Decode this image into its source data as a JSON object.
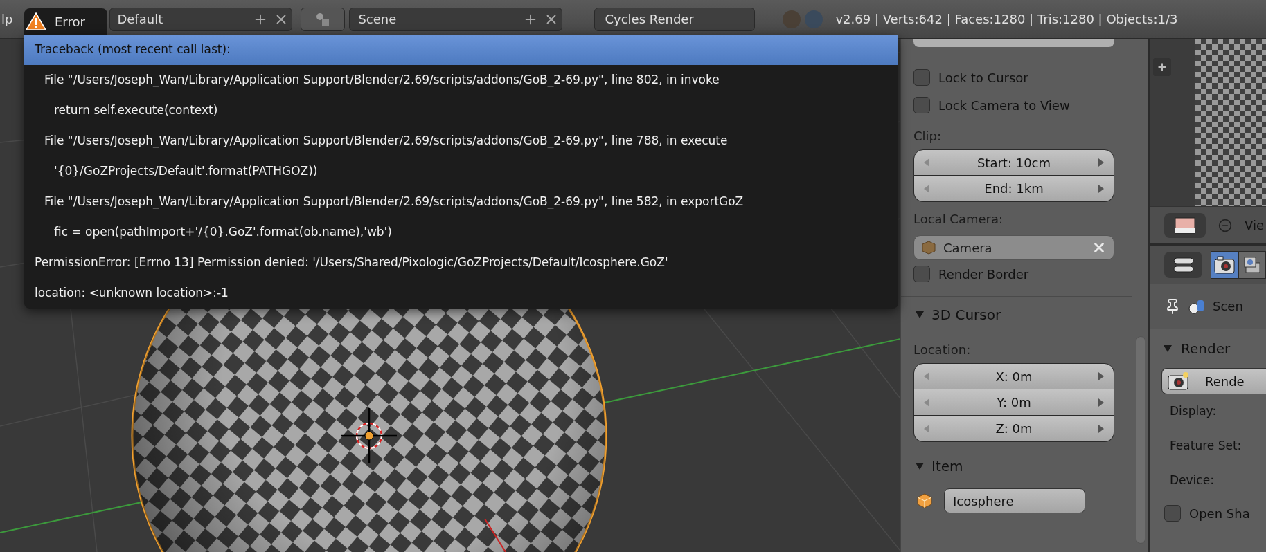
{
  "topbar": {
    "menu_fragment": "lp",
    "layout_field": "Default",
    "scene_field": "Scene",
    "engine": "Cycles Render",
    "stats": "v2.69 | Verts:642 | Faces:1280 | Tris:1280 | Objects:1/3"
  },
  "error_popup": {
    "title": "Error",
    "lines": [
      {
        "kind": "header",
        "text": "Traceback (most recent call last):",
        "selected": true
      },
      {
        "kind": "frame",
        "text": "File \"/Users/Joseph_Wan/Library/Application Support/Blender/2.69/scripts/addons/GoB_2-69.py\", line 802, in invoke",
        "selected": false
      },
      {
        "kind": "code",
        "text": "return self.execute(context)",
        "selected": false
      },
      {
        "kind": "frame",
        "text": "File \"/Users/Joseph_Wan/Library/Application Support/Blender/2.69/scripts/addons/GoB_2-69.py\", line 788, in execute",
        "selected": false
      },
      {
        "kind": "code",
        "text": "'{0}/GoZProjects/Default'.format(PATHGOZ))",
        "selected": false
      },
      {
        "kind": "frame",
        "text": "File \"/Users/Joseph_Wan/Library/Application Support/Blender/2.69/scripts/addons/GoB_2-69.py\", line 582, in exportGoZ",
        "selected": false
      },
      {
        "kind": "code",
        "text": "fic = open(pathImport+'/{0}.GoZ'.format(ob.name),'wb')",
        "selected": false
      },
      {
        "kind": "header",
        "text": "PermissionError: [Errno 13] Permission denied: '/Users/Shared/Pixologic/GoZProjects/Default/Icosphere.GoZ'",
        "selected": false
      },
      {
        "kind": "header",
        "text": "location: <unknown location>:-1",
        "selected": false
      }
    ]
  },
  "view_panel": {
    "items": [
      {
        "kind": "checkbox",
        "label": "Lock to Cursor",
        "checked": false
      },
      {
        "kind": "checkbox",
        "label": "Lock Camera to View",
        "checked": false
      },
      {
        "kind": "label",
        "text": "Clip:"
      },
      {
        "kind": "numbers",
        "fields": [
          {
            "label": "Start:",
            "value": "10cm"
          },
          {
            "label": "End:",
            "value": "1km"
          }
        ]
      },
      {
        "kind": "label",
        "text": "Local Camera:"
      },
      {
        "kind": "object_field",
        "value": "Camera"
      },
      {
        "kind": "checkbox",
        "label": "Render Border",
        "checked": false
      }
    ]
  },
  "panels": [
    {
      "title": "3D Cursor",
      "expanded": true,
      "items": [
        {
          "kind": "label",
          "text": "Location:"
        },
        {
          "kind": "numbers",
          "fields": [
            {
              "label": "X:",
              "value": "0m"
            },
            {
              "label": "Y:",
              "value": "0m"
            },
            {
              "label": "Z:",
              "value": "0m"
            }
          ]
        }
      ]
    },
    {
      "title": "Item",
      "expanded": true,
      "items": [
        {
          "kind": "name_field",
          "value": "Icosphere"
        }
      ]
    }
  ],
  "image_editor": {
    "view_menu": "Vie"
  },
  "properties_editor": {
    "tabs": [
      {
        "kind": "render",
        "selected": true
      },
      {
        "kind": "layers",
        "selected": false
      }
    ],
    "breadcrumb": "Scen",
    "panel": {
      "title": "Render",
      "expanded": true,
      "render_button": "Rende",
      "labels": [
        "Display:",
        "Feature Set:",
        "Device:"
      ],
      "checkbox": {
        "label": "Open Sha",
        "checked": false
      }
    }
  }
}
